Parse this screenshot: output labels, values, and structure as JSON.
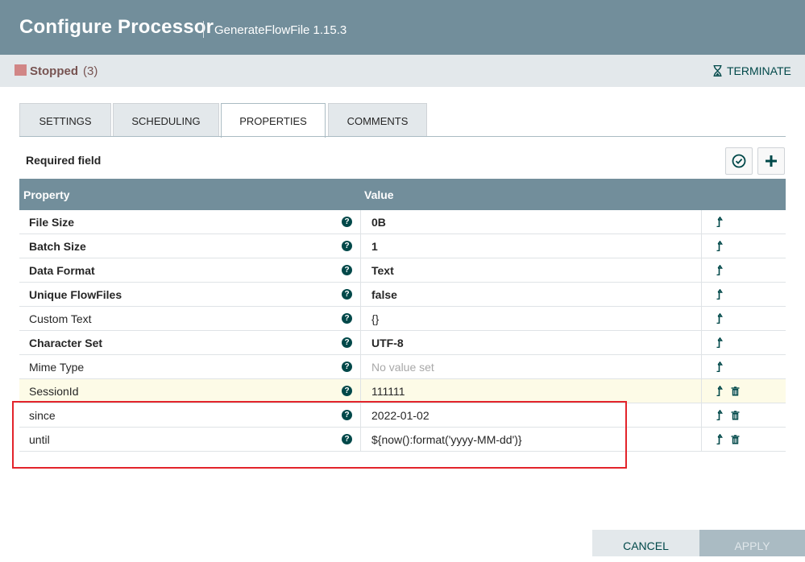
{
  "header": {
    "title": "Configure Processor",
    "subtitle": "GenerateFlowFile 1.15.3"
  },
  "status": {
    "label": "Stopped",
    "count": "(3)",
    "color": "#d18686"
  },
  "terminate_label": "TERMINATE",
  "tabs": [
    {
      "label": "SETTINGS"
    },
    {
      "label": "SCHEDULING"
    },
    {
      "label": "PROPERTIES"
    },
    {
      "label": "COMMENTS"
    }
  ],
  "active_tab": "PROPERTIES",
  "required_label": "Required field",
  "table": {
    "headers": {
      "property": "Property",
      "value": "Value"
    },
    "rows": [
      {
        "name": "File Size",
        "value": "0B",
        "required": true
      },
      {
        "name": "Batch Size",
        "value": "1",
        "required": true
      },
      {
        "name": "Data Format",
        "value": "Text",
        "required": true
      },
      {
        "name": "Unique FlowFiles",
        "value": "false",
        "required": true
      },
      {
        "name": "Custom Text",
        "value": "{}",
        "required": false
      },
      {
        "name": "Character Set",
        "value": "UTF-8",
        "required": true
      },
      {
        "name": "Mime Type",
        "value": "No value set",
        "required": false,
        "empty": true
      },
      {
        "name": "SessionId",
        "value": "111111",
        "required": false,
        "deletable": true,
        "highlighted": true
      },
      {
        "name": "since",
        "value": "2022-01-02",
        "required": false,
        "deletable": true
      },
      {
        "name": "until",
        "value": "${now():format('yyyy-MM-dd')}",
        "required": false,
        "deletable": true
      }
    ]
  },
  "footer": {
    "cancel": "CANCEL",
    "apply": "APPLY"
  },
  "colors": {
    "header": "#728e9b",
    "accent": "#004849",
    "highlight": "#e3242b"
  }
}
